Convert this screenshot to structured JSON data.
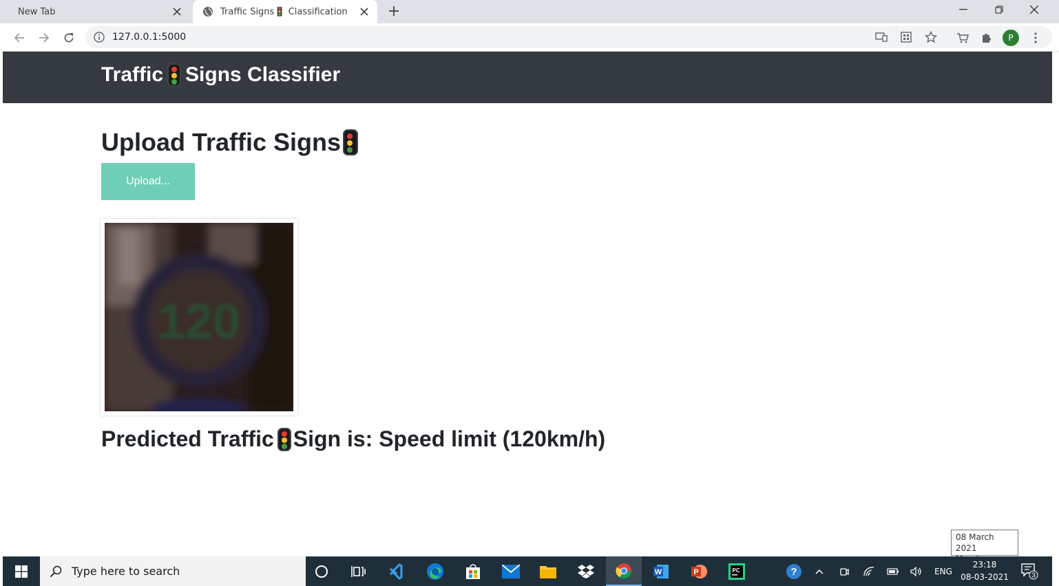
{
  "browser": {
    "tabs": [
      {
        "title": "New Tab",
        "active": false
      },
      {
        "title": "Traffic Signs🚦 Classification",
        "active": true
      }
    ],
    "url": "127.0.0.1:5000",
    "profile_initial": "P"
  },
  "page": {
    "brand": {
      "before": "Traffic",
      "after": "Signs Classifier"
    },
    "heading": "Upload Traffic Signs",
    "upload_label": "Upload...",
    "result": {
      "before": "Predicted Traffic",
      "after": "Sign is: Speed limit (120km/h)"
    },
    "image_alt": "uploaded traffic sign image showing speed limit 120",
    "image_sign_text": "120"
  },
  "taskbar": {
    "search_placeholder": "Type here to search",
    "apps": [
      "cortana-icon",
      "task-view-icon",
      "vscode-icon",
      "edge-icon",
      "store-icon",
      "mail-icon",
      "file-explorer-icon",
      "dropbox-icon",
      "chrome-icon",
      "word-icon",
      "powerpoint-icon",
      "pycharm-icon"
    ],
    "language": "ENG",
    "time": "23:18",
    "date": "08-03-2021",
    "notifications": "3",
    "tooltip": {
      "line1": "08 March 2021",
      "line2": "Monday"
    }
  },
  "colors": {
    "navbar": "#343a40",
    "upload_button": "#6fcfb6",
    "text": "#212529"
  }
}
